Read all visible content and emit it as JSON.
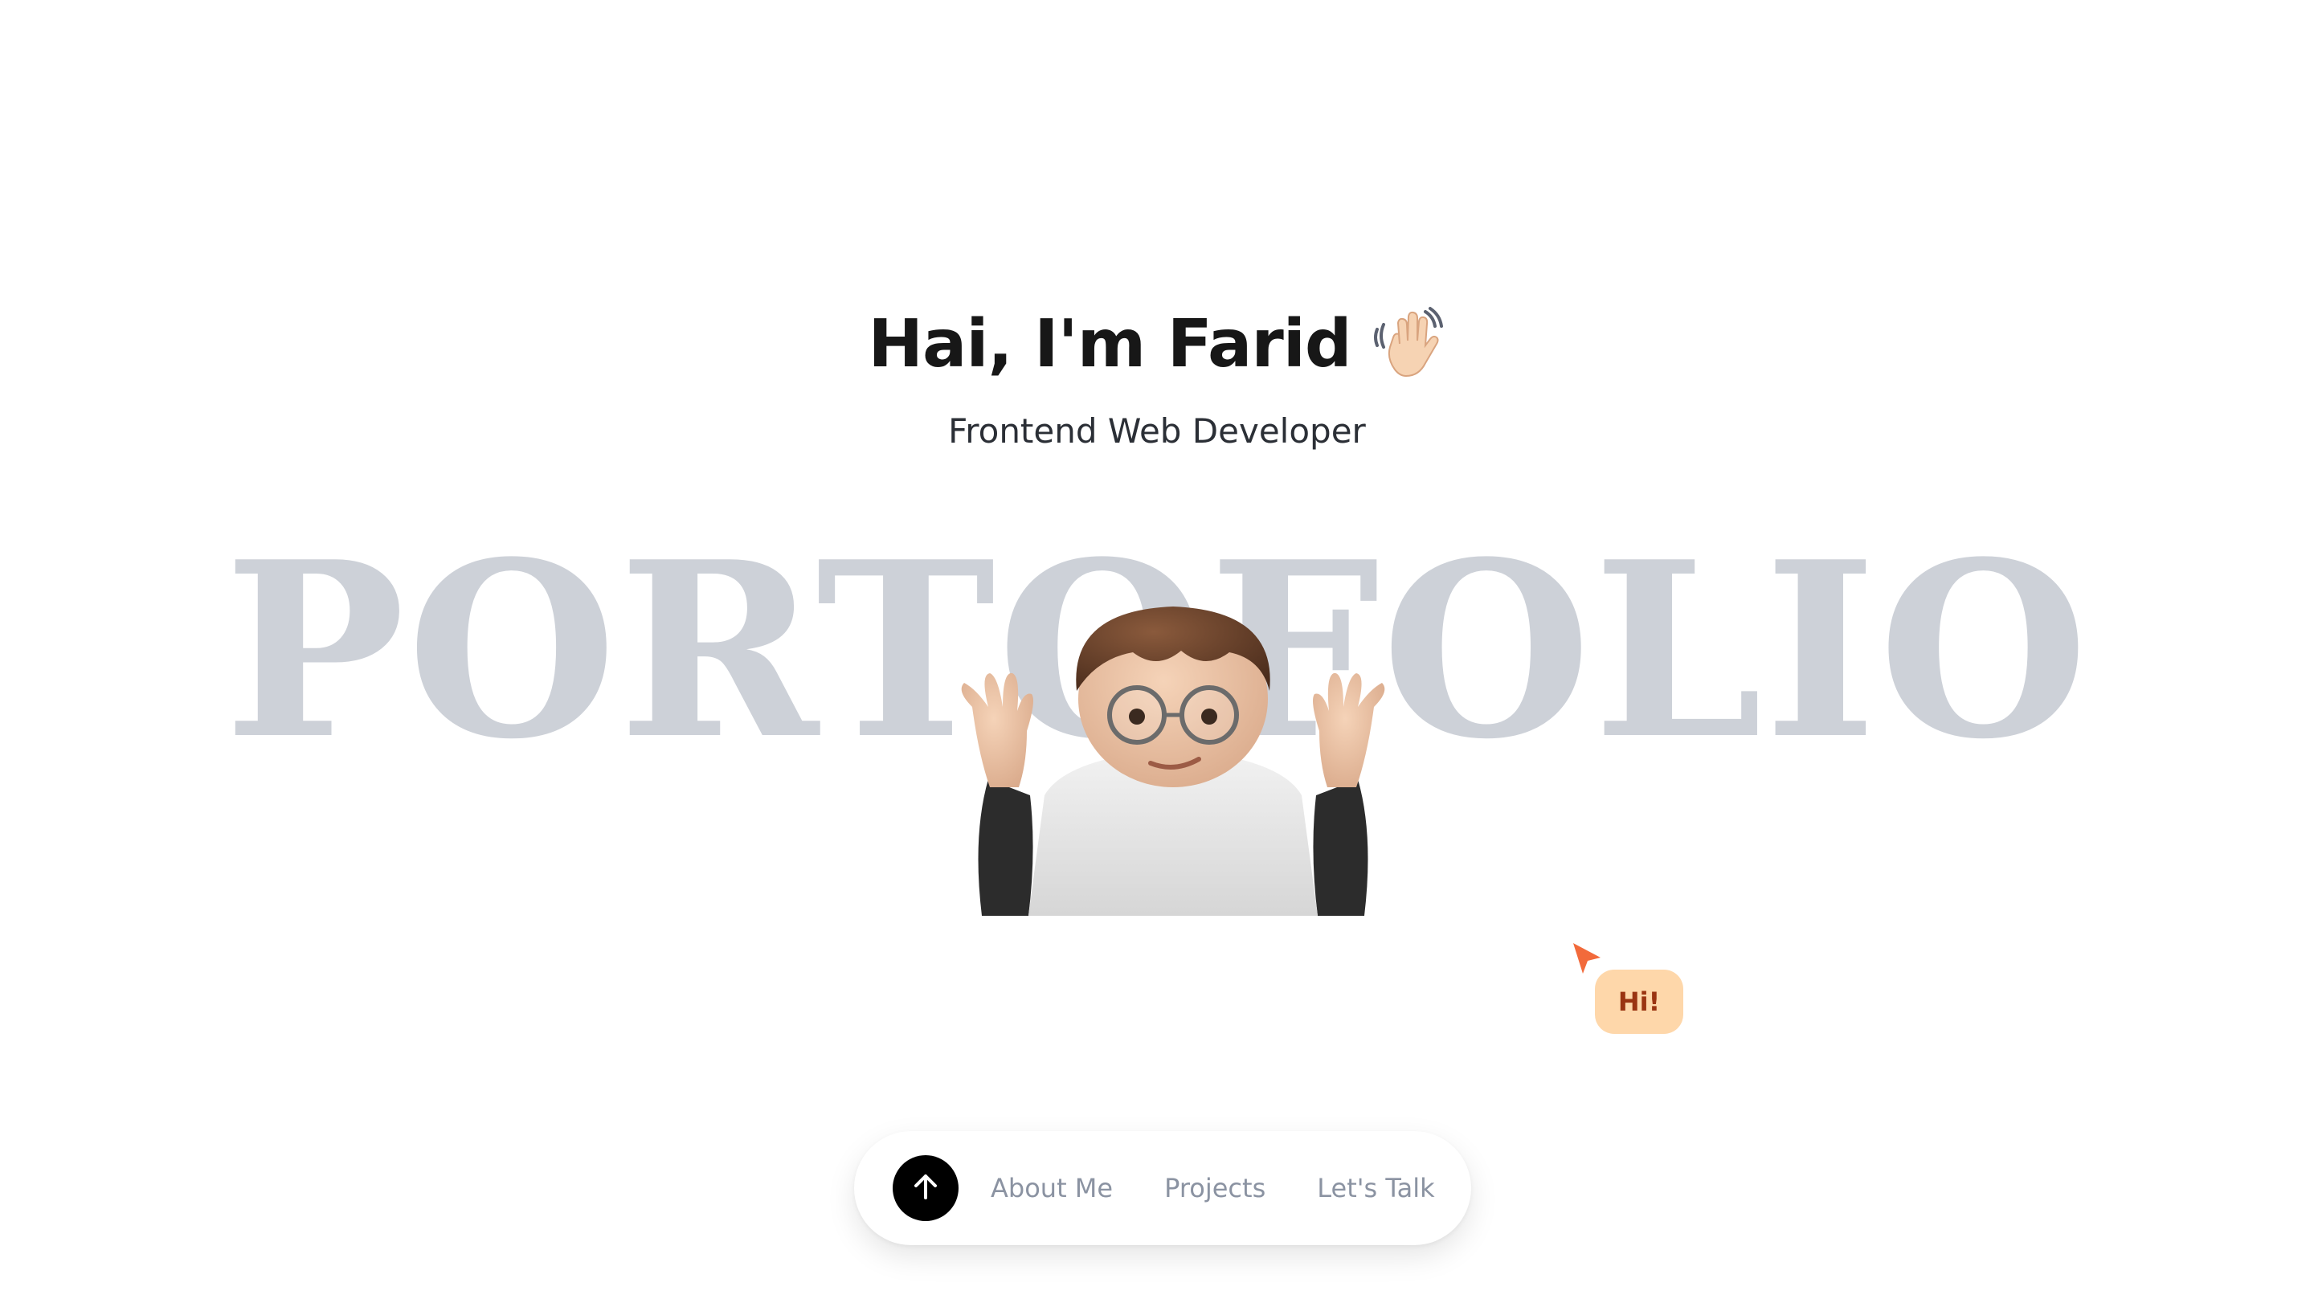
{
  "hero": {
    "title": "Hai, I'm Farid",
    "emoji_icon": "waving-hand-icon",
    "subtitle": "Frontend Web Developer",
    "background_word": "PORTOFOLIO"
  },
  "avatar": {
    "icon": "memoji-avatar-shrug"
  },
  "cursor": {
    "icon": "pointer-arrow-icon",
    "color": "#f26a3b",
    "bubble_text": "Hi!",
    "bubble_color": "#fed7aa",
    "bubble_text_color": "#9a3412"
  },
  "nav": {
    "top_button_icon": "arrow-up-icon",
    "items": [
      {
        "label": "About Me"
      },
      {
        "label": "Projects"
      },
      {
        "label": "Let's Talk"
      }
    ]
  },
  "colors": {
    "background": "#ffffff",
    "title": "#171717",
    "background_word": "#cdd1d8",
    "nav_text": "#8b93a2",
    "nav_button": "#000000"
  }
}
